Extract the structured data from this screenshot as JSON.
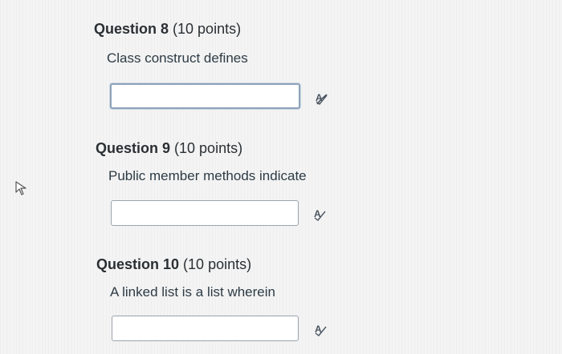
{
  "questions": [
    {
      "heading": "Question 8",
      "points": "(10 points)",
      "prompt": "Class construct defines",
      "answer_value": "",
      "spell_icon": "spell-check-icon"
    },
    {
      "heading": "Question 9",
      "points": "(10 points)",
      "prompt": "Public member methods indicate",
      "answer_value": "",
      "spell_icon": "spell-check-icon"
    },
    {
      "heading": "Question 10",
      "points": "(10 points)",
      "prompt": "A linked list is a list wherein",
      "answer_value": "",
      "spell_icon": "spell-check-icon"
    }
  ],
  "cursor_icon": "mouse-pointer-icon"
}
